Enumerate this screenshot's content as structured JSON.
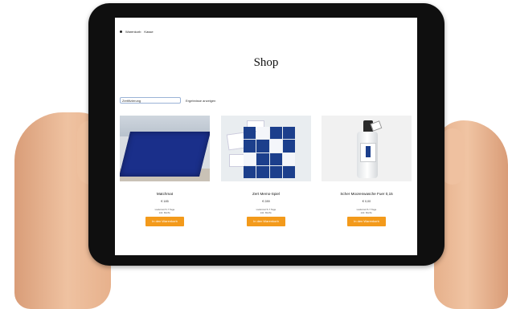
{
  "nav": {
    "items": [
      "Warenkorb",
      "Kasse"
    ]
  },
  "page": {
    "title": "Shop"
  },
  "search": {
    "value": "Zertifizierung",
    "link": "Ergebnisse anzeigen"
  },
  "products": [
    {
      "name": "Matchmat",
      "price": "€ 185",
      "info_line1": "Lieferzeit 5-7 Tage",
      "info_line2": "inkl. MwSt.",
      "button": "In den Warenkorb",
      "image_icon": "blue-mat-image"
    },
    {
      "name": "Zert Memo-Spiel",
      "price": "€ 289",
      "info_line1": "Lieferzeit 5-7 Tage",
      "info_line2": "inkl. MwSt.",
      "button": "In den Warenkorb",
      "image_icon": "memo-cards-image"
    },
    {
      "name": "Scher Moorenwasche Fuer 0,15",
      "price": "€ 0,00",
      "info_line1": "Lieferzeit 5-7 Tage",
      "info_line2": "inkl. MwSt.",
      "button": "In den Warenkorb",
      "image_icon": "spray-bottle-image"
    }
  ],
  "colors": {
    "accent_button": "#f39a1b",
    "tablet_frame": "#0f0f0f",
    "product_blue": "#1c3f8c"
  }
}
